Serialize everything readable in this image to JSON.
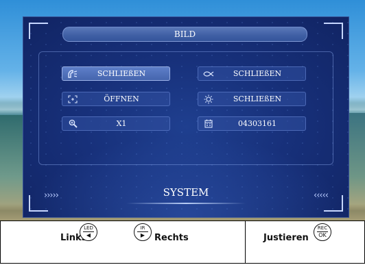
{
  "panel": {
    "title": "BILD",
    "rows": [
      {
        "left": {
          "icon": "headlight-icon",
          "label": "SCHLIEßEN",
          "active": true
        },
        "right": {
          "icon": "fog-light-icon",
          "label": "SCHLIEßEN",
          "active": false
        }
      },
      {
        "left": {
          "icon": "frame-icon",
          "label": "ÖFFNEN",
          "active": false
        },
        "right": {
          "icon": "brightness-icon",
          "label": "SCHLIEßEN",
          "active": false
        }
      },
      {
        "left": {
          "icon": "zoom-icon",
          "label": "X1",
          "active": false
        },
        "right": {
          "icon": "calendar-icon",
          "label": "04303161",
          "active": false
        }
      }
    ],
    "footer": {
      "label": "SYSTEM",
      "left_arrows": "›››››",
      "right_arrows": "‹‹‹‹‹"
    }
  },
  "bar": {
    "links": "Links",
    "rechts": "Rechts",
    "justieren": "Justieren",
    "key_led": {
      "top": "LED",
      "bottom": "◀"
    },
    "key_ir": {
      "top": "IR",
      "bottom": "▶"
    },
    "key_rec": {
      "top": "REC",
      "bottom": "OK"
    }
  }
}
